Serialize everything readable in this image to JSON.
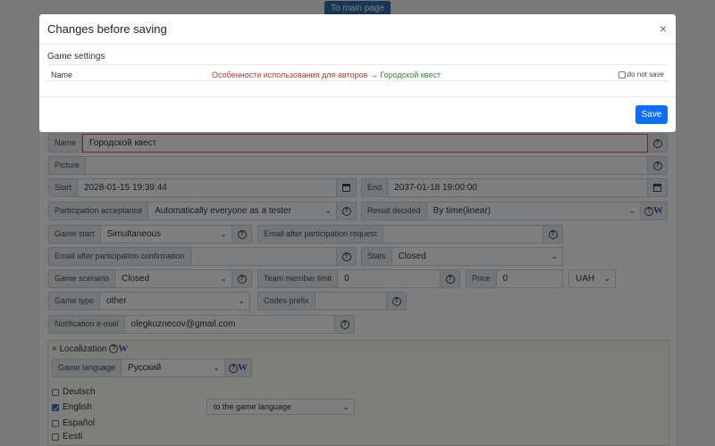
{
  "top_button": "To main page",
  "modal": {
    "title": "Changes before saving",
    "close_icon": "×",
    "section": "Game settings",
    "change_row": {
      "field": "Name",
      "old_value": "Особенности использования для авторов",
      "arrow": "→",
      "new_value": "Городской квест",
      "do_not_save_label": "do not save"
    },
    "save_label": "Save"
  },
  "form": {
    "name": {
      "label": "Name",
      "value": "Городской квест"
    },
    "picture": {
      "label": "Picture",
      "value": ""
    },
    "start": {
      "label": "Start",
      "value": "2028-01-15 19:39:44"
    },
    "end": {
      "label": "End",
      "value": "2037-01-18 19:00:00"
    },
    "participation": {
      "label": "Participation acceptance",
      "value": "Automatically everyone as a tester"
    },
    "result_decided": {
      "label": "Result decided",
      "value": "By time(linear)"
    },
    "game_start": {
      "label": "Game start",
      "value": "Simultaneous"
    },
    "email_after_request": {
      "label": "Email after participation request",
      "value": ""
    },
    "email_after_confirmation": {
      "label": "Email after participation confirmation",
      "value": ""
    },
    "stats": {
      "label": "Stats",
      "value": "Closed"
    },
    "game_scenario": {
      "label": "Game scenario",
      "value": "Closed"
    },
    "team_member_limit": {
      "label": "Team member limit",
      "value": "0"
    },
    "price": {
      "label": "Price",
      "value": "0",
      "currency": "UAH"
    },
    "game_type": {
      "label": "Game type",
      "value": "other"
    },
    "codes_prefix": {
      "label": "Codes prefix",
      "value": ""
    },
    "notification_email": {
      "label": "Notification e-mail",
      "value": "olegkuznecov@gmail.com"
    }
  },
  "localization": {
    "header": "Localization",
    "close_mark": "×",
    "game_language_label": "Game language",
    "game_language_value": "Русский",
    "languages": [
      {
        "name": "Deutsch",
        "checked": false
      },
      {
        "name": "English",
        "checked": true
      },
      {
        "name": "Español",
        "checked": false
      },
      {
        "name": "Eesti",
        "checked": false
      }
    ],
    "english_translation_mode": "to the game language"
  },
  "glyphs": {
    "question": "?",
    "wiki": "W",
    "chevron": "⌄"
  },
  "colors": {
    "primary": "#0d6efd",
    "old_value": "#c0392b",
    "new_value": "#2e8b2e",
    "overlay": "rgba(0,0,0,0.5)"
  }
}
